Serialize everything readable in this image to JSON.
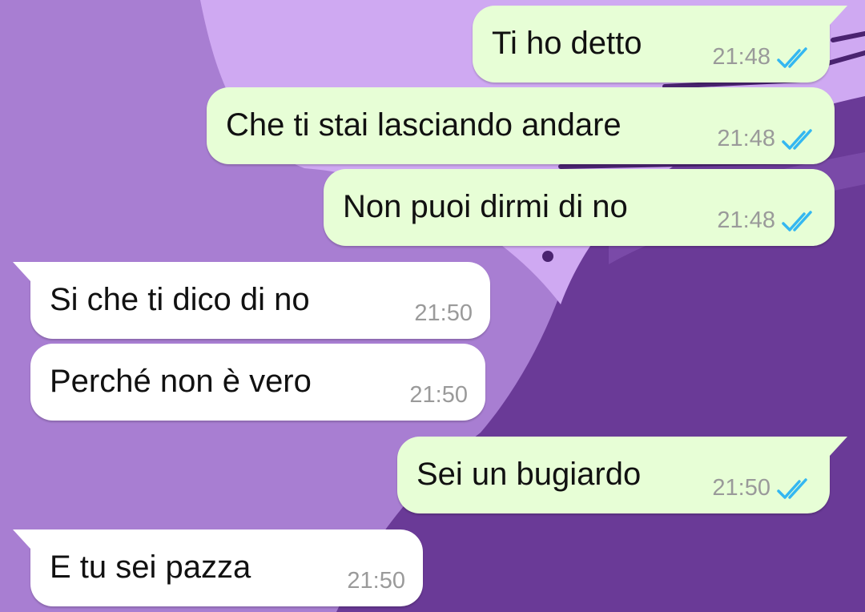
{
  "colors": {
    "wallpaper_dark": "#6a3a97",
    "wallpaper_mid": "#a87ed2",
    "wallpaper_light": "#cfa9f2",
    "outgoing_bubble": "#e7fed6",
    "incoming_bubble": "#ffffff",
    "read_check": "#34b7f1",
    "timestamp": "#9a9a9a"
  },
  "messages": [
    {
      "direction": "out",
      "text": "Ti ho detto",
      "time": "21:48",
      "status_icon": "double-check-read-icon"
    },
    {
      "direction": "out",
      "text": "Che ti stai lasciando andare",
      "time": "21:48",
      "status_icon": "double-check-read-icon"
    },
    {
      "direction": "out",
      "text": "Non puoi dirmi di no",
      "time": "21:48",
      "status_icon": "double-check-read-icon"
    },
    {
      "direction": "in",
      "text": "Si che ti dico di no",
      "time": "21:50"
    },
    {
      "direction": "in",
      "text": "Perché non è vero",
      "time": "21:50"
    },
    {
      "direction": "out",
      "text": "Sei un bugiardo",
      "time": "21:50",
      "status_icon": "double-check-read-icon"
    },
    {
      "direction": "in",
      "text": "E tu sei pazza",
      "time": "21:50"
    }
  ]
}
